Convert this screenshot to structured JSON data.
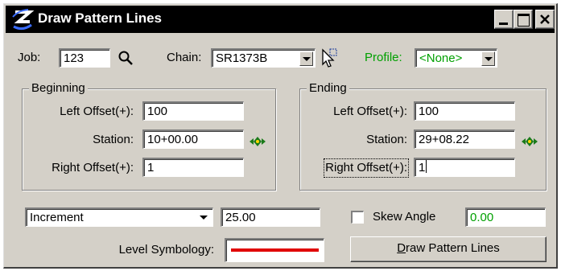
{
  "window": {
    "title": "Draw Pattern Lines",
    "minimize_icon": "minimize-icon",
    "maximize_icon": "maximize-icon",
    "close_icon": "close-icon"
  },
  "top_row": {
    "job_label": "Job:",
    "job_value": "123",
    "chain_label": "Chain:",
    "chain_value": "SR1373B",
    "profile_label": "Profile:",
    "profile_value": "<None>"
  },
  "beginning": {
    "title": "Beginning",
    "left_offset_label": "Left Offset(+):",
    "left_offset_value": "100",
    "station_label": "Station:",
    "station_value": "10+00.00",
    "right_offset_label": "Right Offset(+):",
    "right_offset_value": "1"
  },
  "ending": {
    "title": "Ending",
    "left_offset_label": "Left Offset(+):",
    "left_offset_value": "100",
    "station_label": "Station:",
    "station_value": "29+08.22",
    "right_offset_label": "Right Offset(+):",
    "right_offset_value": "1"
  },
  "bottom": {
    "mode_value": "Increment",
    "increment_value": "25.00",
    "skew_label": "Skew Angle",
    "skew_value": "0.00",
    "skew_checked": false,
    "level_symbology_label": "Level Symbology:",
    "draw_button_label": "Draw Pattern Lines"
  },
  "colors": {
    "title_bar": "#000000",
    "dialog_bg": "#d4d0c8",
    "profile_label": "#00a000",
    "skew_value": "#00a000",
    "symbology_line": "#e00000",
    "locate_icon": "#1a7a1a"
  }
}
